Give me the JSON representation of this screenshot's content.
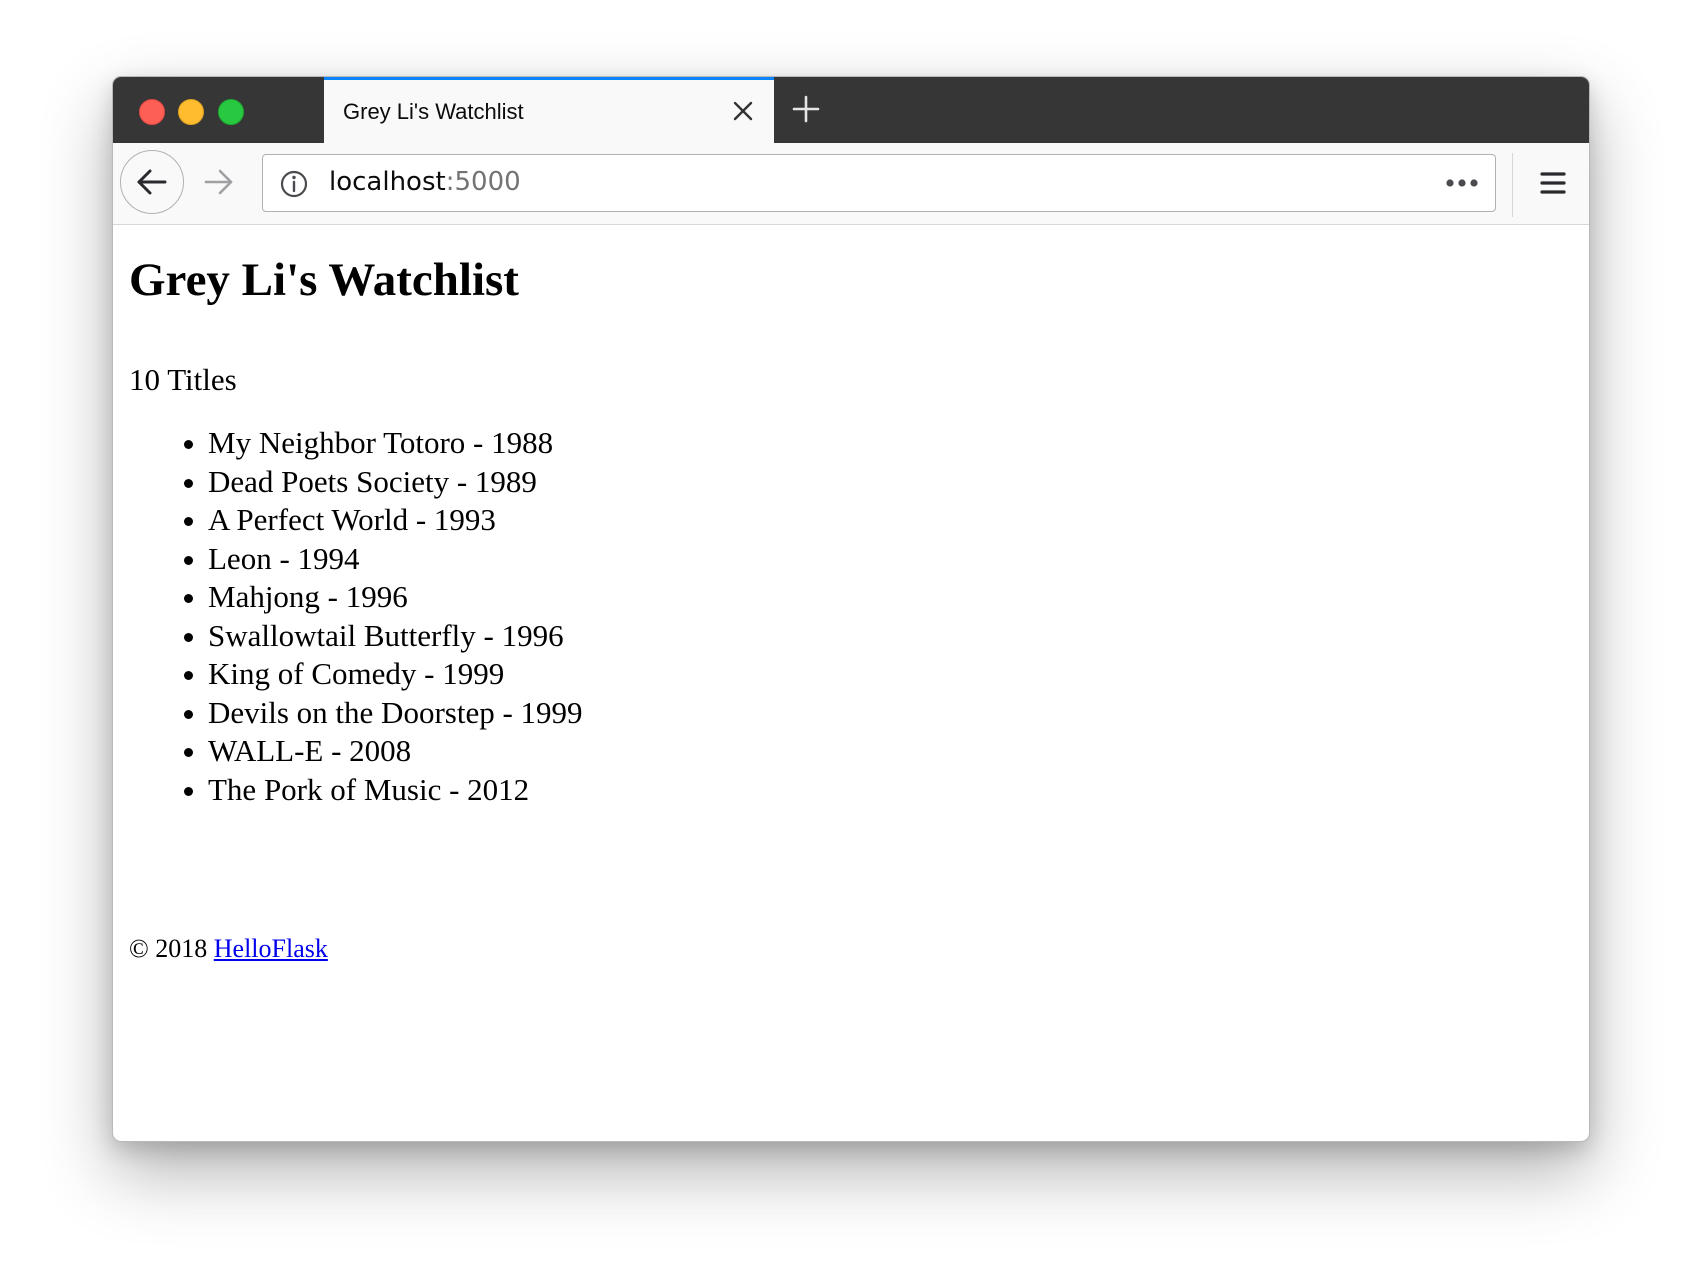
{
  "browser": {
    "tab_title": "Grey Li's Watchlist",
    "url_host": "localhost",
    "url_port": ":5000"
  },
  "icons": {
    "traffic_lights": [
      "close-traffic-light",
      "minimize-traffic-light",
      "zoom-traffic-light"
    ],
    "tab_close": "close-icon",
    "new_tab": "plus-icon",
    "back": "back-arrow-icon",
    "forward": "forward-arrow-icon",
    "site_info": "info-icon",
    "page_actions": "more-horizontal-icon",
    "menu": "hamburger-menu-icon"
  },
  "colors": {
    "tab_accent": "#0a84ff",
    "tabbar_bg": "#363636",
    "link": "#0000ee",
    "traffic_close": "#fd5f57",
    "traffic_min": "#febc2e",
    "traffic_max": "#28c840"
  },
  "page": {
    "title": "Grey Li's Watchlist",
    "count_text": "10 Titles",
    "movies": [
      "My Neighbor Totoro - 1988",
      "Dead Poets Society - 1989",
      "A Perfect World - 1993",
      "Leon - 1994",
      "Mahjong - 1996",
      "Swallowtail Butterfly - 1996",
      "King of Comedy - 1999",
      "Devils on the Doorstep - 1999",
      "WALL-E - 2008",
      "The Pork of Music - 2012"
    ],
    "footer": {
      "prefix": "© 2018 ",
      "link_text": "HelloFlask"
    }
  }
}
